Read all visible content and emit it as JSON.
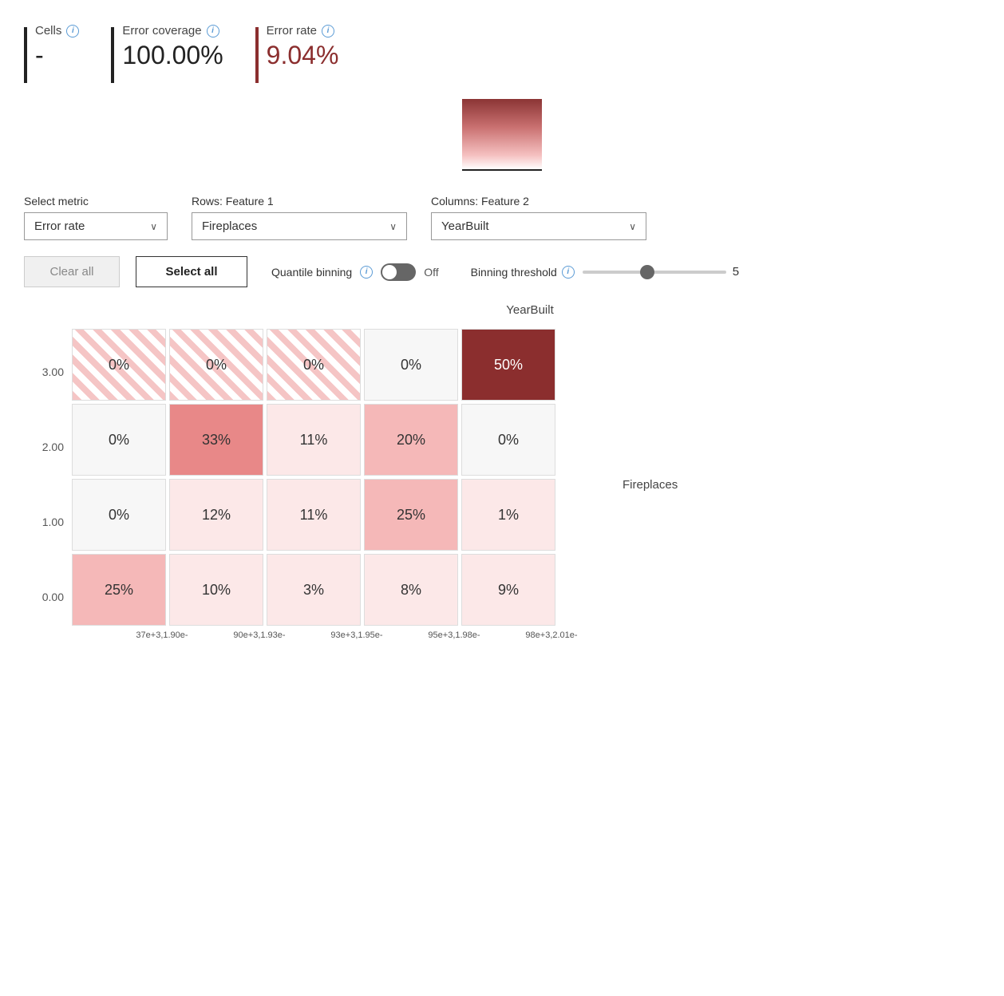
{
  "metrics": {
    "cells": {
      "label": "Cells",
      "value": "-"
    },
    "error_coverage": {
      "label": "Error coverage",
      "value": "100.00%"
    },
    "error_rate": {
      "label": "Error rate",
      "value": "9.04%"
    }
  },
  "controls": {
    "metric_label": "Select metric",
    "metric_value": "Error rate",
    "metric_chevron": "∨",
    "rows_label": "Rows: Feature 1",
    "rows_value": "Fireplaces",
    "rows_chevron": "∨",
    "columns_label": "Columns: Feature 2",
    "columns_value": "YearBuilt",
    "columns_chevron": "∨",
    "clear_all": "Clear all",
    "select_all": "Select all",
    "quantile_label": "Quantile binning",
    "quantile_state": "Off",
    "binning_label": "Binning threshold",
    "binning_value": "5",
    "slider_min": 1,
    "slider_max": 10,
    "slider_current": 5
  },
  "matrix": {
    "column_header": "YearBuilt",
    "row_header": "Fireplaces",
    "x_labels": [
      "37e+3,1.90e-",
      "90e+3,1.93e-",
      "93e+3,1.95e-",
      "95e+3,1.98e-",
      "98e+3,2.01e-"
    ],
    "y_labels": [
      "3.00",
      "2.00",
      "1.00",
      "0.00"
    ],
    "rows": [
      [
        {
          "value": "0%",
          "style": "hatched",
          "white": false
        },
        {
          "value": "0%",
          "style": "hatched",
          "white": false
        },
        {
          "value": "0%",
          "style": "hatched",
          "white": false
        },
        {
          "value": "0%",
          "style": "c-0",
          "white": false
        },
        {
          "value": "50%",
          "style": "c-5",
          "white": true
        }
      ],
      [
        {
          "value": "0%",
          "style": "c-0",
          "white": false
        },
        {
          "value": "33%",
          "style": "c-3",
          "white": false
        },
        {
          "value": "11%",
          "style": "c-1",
          "white": false
        },
        {
          "value": "20%",
          "style": "c-2",
          "white": false
        },
        {
          "value": "0%",
          "style": "c-0",
          "white": false
        }
      ],
      [
        {
          "value": "0%",
          "style": "c-0",
          "white": false
        },
        {
          "value": "12%",
          "style": "c-1",
          "white": false
        },
        {
          "value": "11%",
          "style": "c-1",
          "white": false
        },
        {
          "value": "25%",
          "style": "c-2",
          "white": false
        },
        {
          "value": "1%",
          "style": "c-1",
          "white": false
        }
      ],
      [
        {
          "value": "25%",
          "style": "c-2",
          "white": false
        },
        {
          "value": "10%",
          "style": "c-1",
          "white": false
        },
        {
          "value": "3%",
          "style": "c-1",
          "white": false
        },
        {
          "value": "8%",
          "style": "c-1",
          "white": false
        },
        {
          "value": "9%",
          "style": "c-1",
          "white": false
        }
      ]
    ]
  }
}
